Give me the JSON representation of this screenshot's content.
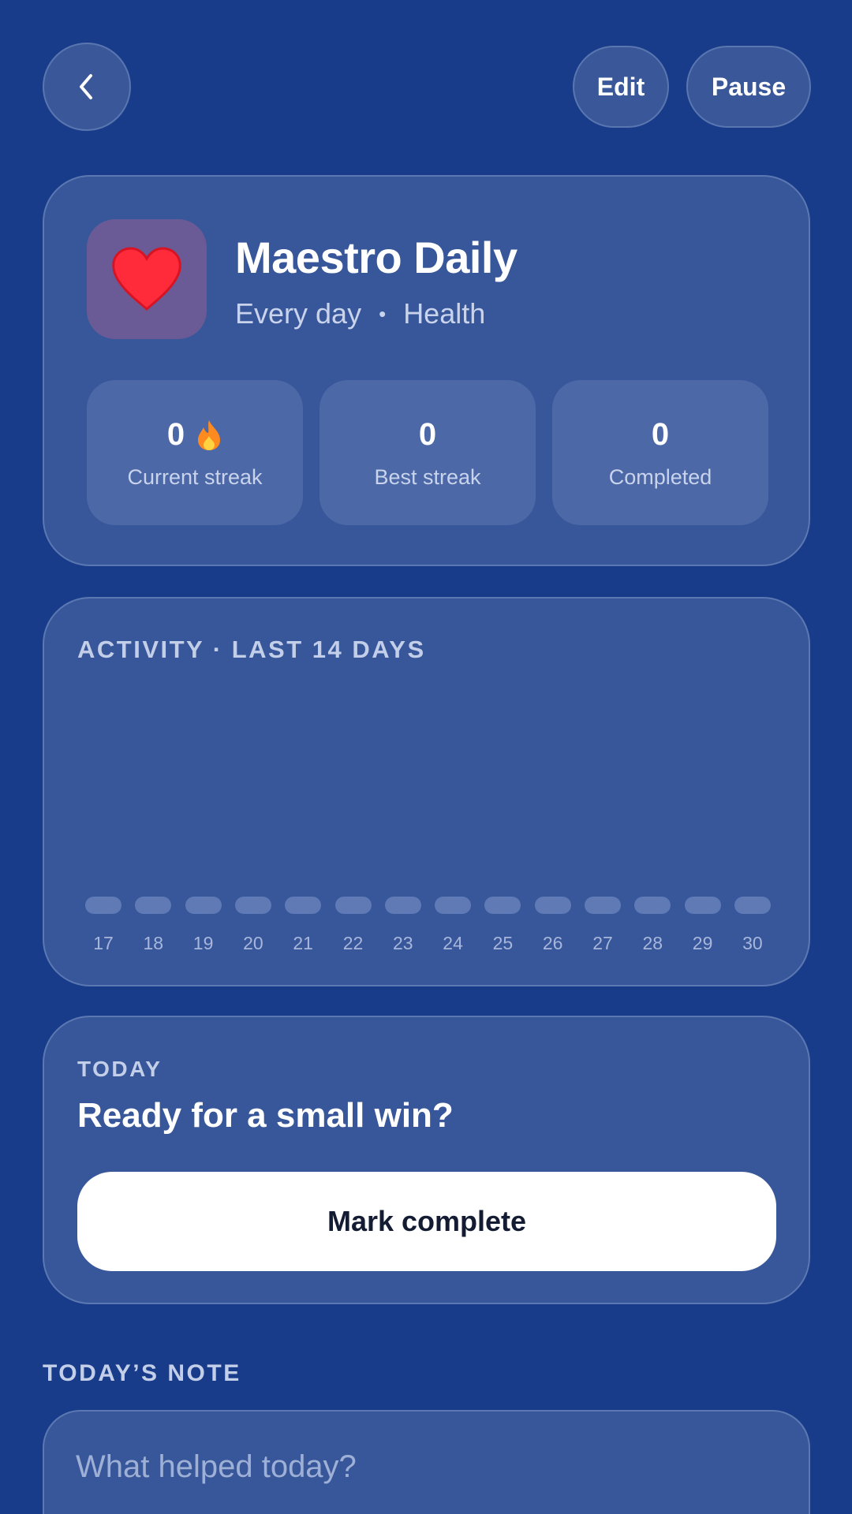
{
  "header": {
    "edit_label": "Edit",
    "pause_label": "Pause"
  },
  "habit": {
    "icon": "heart-icon",
    "icon_color": "#ff2a3a",
    "title": "Maestro Daily",
    "frequency": "Every day",
    "separator": "•",
    "category": "Health"
  },
  "stats": [
    {
      "value": "0",
      "label": "Current streak",
      "icon": "flame-icon"
    },
    {
      "value": "0",
      "label": "Best streak"
    },
    {
      "value": "0",
      "label": "Completed"
    }
  ],
  "activity": {
    "label": "ACTIVITY · LAST 14 DAYS",
    "days": [
      {
        "day": "17",
        "completed": false
      },
      {
        "day": "18",
        "completed": false
      },
      {
        "day": "19",
        "completed": false
      },
      {
        "day": "20",
        "completed": false
      },
      {
        "day": "21",
        "completed": false
      },
      {
        "day": "22",
        "completed": false
      },
      {
        "day": "23",
        "completed": false
      },
      {
        "day": "24",
        "completed": false
      },
      {
        "day": "25",
        "completed": false
      },
      {
        "day": "26",
        "completed": false
      },
      {
        "day": "27",
        "completed": false
      },
      {
        "day": "28",
        "completed": false
      },
      {
        "day": "29",
        "completed": false
      },
      {
        "day": "30",
        "completed": false
      }
    ]
  },
  "today": {
    "label": "TODAY",
    "title": "Ready for a small win?",
    "button_label": "Mark complete"
  },
  "note": {
    "label": "TODAY’S NOTE",
    "placeholder": "What helped today?"
  },
  "colors": {
    "background": "#183c8a",
    "card": "#38579a",
    "accent_button": "#ffffff"
  }
}
